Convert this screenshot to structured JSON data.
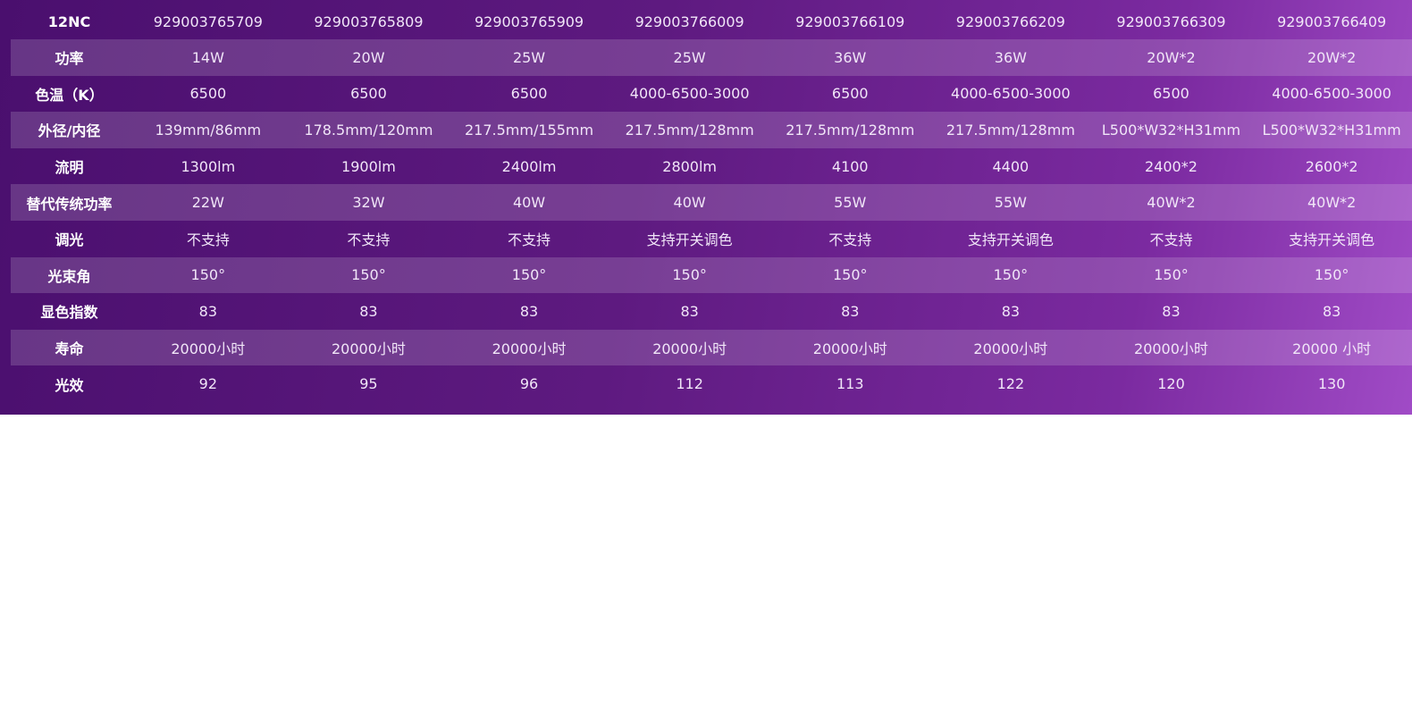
{
  "spec_table": {
    "rows": [
      {
        "label": "12NC",
        "values": [
          "929003765709",
          "929003765809",
          "929003765909",
          "929003766009",
          "929003766109",
          "929003766209",
          "929003766309",
          "929003766409"
        ]
      },
      {
        "label": "功率",
        "values": [
          "14W",
          "20W",
          "25W",
          "25W",
          "36W",
          "36W",
          "20W*2",
          "20W*2"
        ]
      },
      {
        "label": "色温（K）",
        "values": [
          "6500",
          "6500",
          "6500",
          "4000-6500-3000",
          "6500",
          "4000-6500-3000",
          "6500",
          "4000-6500-3000"
        ]
      },
      {
        "label": "外径/内径",
        "values": [
          "139mm/86mm",
          "178.5mm/120mm",
          "217.5mm/155mm",
          "217.5mm/128mm",
          "217.5mm/128mm",
          "217.5mm/128mm",
          "L500*W32*H31mm",
          "L500*W32*H31mm"
        ]
      },
      {
        "label": "流明",
        "values": [
          "1300lm",
          "1900lm",
          "2400lm",
          "2800lm",
          "4100",
          "4400",
          "2400*2",
          "2600*2"
        ]
      },
      {
        "label": "替代传统功率",
        "values": [
          "22W",
          "32W",
          "40W",
          "40W",
          "55W",
          "55W",
          "40W*2",
          "40W*2"
        ]
      },
      {
        "label": "调光",
        "values": [
          "不支持",
          "不支持",
          "不支持",
          "支持开关调色",
          "不支持",
          "支持开关调色",
          "不支持",
          "支持开关调色"
        ]
      },
      {
        "label": "光束角",
        "values": [
          "150°",
          "150°",
          "150°",
          "150°",
          "150°",
          "150°",
          "150°",
          "150°"
        ]
      },
      {
        "label": "显色指数",
        "values": [
          "83",
          "83",
          "83",
          "83",
          "83",
          "83",
          "83",
          "83"
        ]
      },
      {
        "label": "寿命",
        "values": [
          "20000小时",
          "20000小时",
          "20000小时",
          "20000小时",
          "20000小时",
          "20000小时",
          "20000小时",
          "20000 小时"
        ]
      },
      {
        "label": "光效",
        "values": [
          "92",
          "95",
          "96",
          "112",
          "113",
          "122",
          "120",
          "130"
        ]
      }
    ]
  },
  "colors": {
    "panel_start": "#4a0f6e",
    "panel_end": "#a04bc6",
    "text": "#f1e6f8"
  }
}
